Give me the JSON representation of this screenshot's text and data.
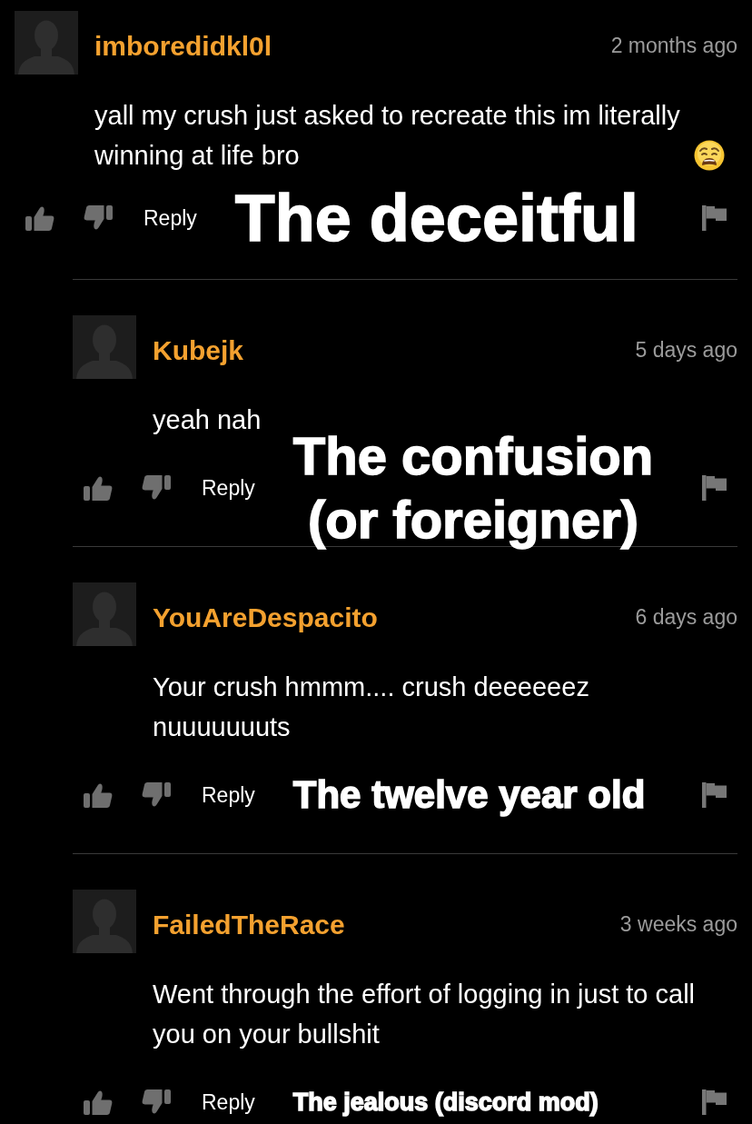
{
  "thread": {
    "username": "imboredidkl0l",
    "time": "2 months ago",
    "text": "yall my crush just asked to recreate this im literally winning at life bro",
    "trailing_emoji": true,
    "reply_label": "Reply",
    "caption": "The deceitful",
    "replies": [
      {
        "username": "Kubejk",
        "time": "5 days ago",
        "text": "yeah nah",
        "reply_label": "Reply",
        "caption": "The confusion\n(or foreigner)"
      },
      {
        "username": "YouAreDespacito",
        "time": "6 days ago",
        "text": "Your crush hmmm.... crush deeeeeez nuuuuuuuts",
        "reply_label": "Reply",
        "caption": "The twelve year old"
      },
      {
        "username": "FailedTheRace",
        "time": "3 weeks ago",
        "text": "Went through the effort of logging in just to call you on your bullshit",
        "reply_label": "Reply",
        "caption": "The jealous (discord mod)"
      }
    ]
  }
}
